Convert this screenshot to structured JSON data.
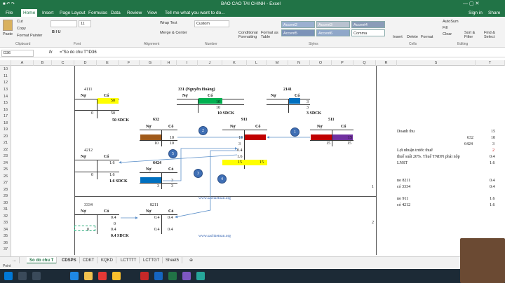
{
  "window": {
    "title": "BAO CAO TAI CHINH - Excel",
    "signin": "Sign in",
    "share": "Share"
  },
  "tabs": [
    "File",
    "Home",
    "Insert",
    "Page Layout",
    "Formulas",
    "Data",
    "Review",
    "View"
  ],
  "tell_me": "Tell me what you want to do...",
  "ribbon": {
    "paste": "Paste",
    "cut": "Cut",
    "copy": "Copy",
    "format_painter": "Format Painter",
    "clipboard": "Clipboard",
    "font_name": "",
    "font_size": "11",
    "font": "Font",
    "wrap_text": "Wrap Text",
    "merge_center": "Merge & Center",
    "alignment": "Alignment",
    "number_format": "Custom",
    "number": "Number",
    "cond_format": "Conditional Formatting",
    "format_table": "Format as Table",
    "styles": [
      "Accent2",
      "Accent3",
      "Accent4",
      "Accent5",
      "Accent6",
      "Comma"
    ],
    "styles_label": "Styles",
    "insert": "Insert",
    "delete": "Delete",
    "format": "Format",
    "cells": "Cells",
    "autosum": "AutoSum",
    "fill": "Fill",
    "clear": "Clear",
    "sort_filter": "Sort & Filter",
    "find_select": "Find & Select",
    "editing": "Editing"
  },
  "formula_bar": {
    "name_box": "D36",
    "fx": "fx",
    "formula": "=\"So do chu T\"!D36"
  },
  "columns": [
    "A",
    "B",
    "C",
    "D",
    "E",
    "F",
    "G",
    "H",
    "I",
    "J",
    "K",
    "L",
    "M",
    "N",
    "O",
    "P",
    "Q",
    "R",
    "S",
    "T"
  ],
  "rows": [
    "10",
    "11",
    "12",
    "13",
    "14",
    "15",
    "16",
    "17",
    "18",
    "19",
    "20",
    "21",
    "22",
    "23",
    "24",
    "25",
    "26",
    "27",
    "28",
    "29",
    "30",
    "31",
    "32",
    "33",
    "34",
    "35",
    "36",
    "37"
  ],
  "sheet": {
    "t4111": "4111",
    "t331": "331 (Nguyễn Hoàng)",
    "t2141": "2141",
    "t632": "632",
    "t911": "911",
    "t511": "511",
    "t4212": "4212",
    "t6424": "6424",
    "t3334": "3334",
    "t8211": "8211",
    "no": "Nợ",
    "co": "Có",
    "v50": "50",
    "v0": "0",
    "v10": "10",
    "v3": "3",
    "v15": "15",
    "v1_6": "1.6",
    "v0_4": "0.4",
    "sdck_50": "50 SDCK",
    "sdck_10": "10 SDCK",
    "sdck_3": "3 SDCK",
    "sdck_1_6": "1.6 SDCK",
    "sdck_0_4": "0.4 SDCK",
    "website": "www.sachketoan.org",
    "side": {
      "doanhthu": "Doanh thu",
      "dt_val": "15",
      "v632": "632",
      "v632_val": "10",
      "v6424": "6424",
      "v6424_val": "3",
      "lntt": "Lợi nhuận trước thuế",
      "lntt_val": "2",
      "thue": "thuế suất 20%. Thuế TNDN phải nộp",
      "thue_val": "0.4",
      "lnst": "LNST",
      "lnst_val": "1.6",
      "no8211": "no 8211",
      "no8211_val": "0.4",
      "co3334": "có 3334",
      "co3334_val": "0.4",
      "no911": "no 911",
      "no911_val": "1.6",
      "co4212": "có 4212",
      "co4212_val": "1.6",
      "one": "1",
      "two": "2"
    },
    "circles": [
      "1",
      "2",
      "3",
      "4",
      "5"
    ]
  },
  "sheet_tabs": [
    "...",
    "So do chu T",
    "CDSPS",
    "CDKT",
    "KQKD",
    "LCTTTT",
    "LCTTGT",
    "Sheet5"
  ],
  "status": "Point",
  "colors": {
    "green": "#217346",
    "yellow": "#ffff00",
    "teal": "#00b050",
    "blue": "#0070c0",
    "brown": "#a05a1a",
    "red": "#c00000",
    "purple": "#7030a0"
  }
}
